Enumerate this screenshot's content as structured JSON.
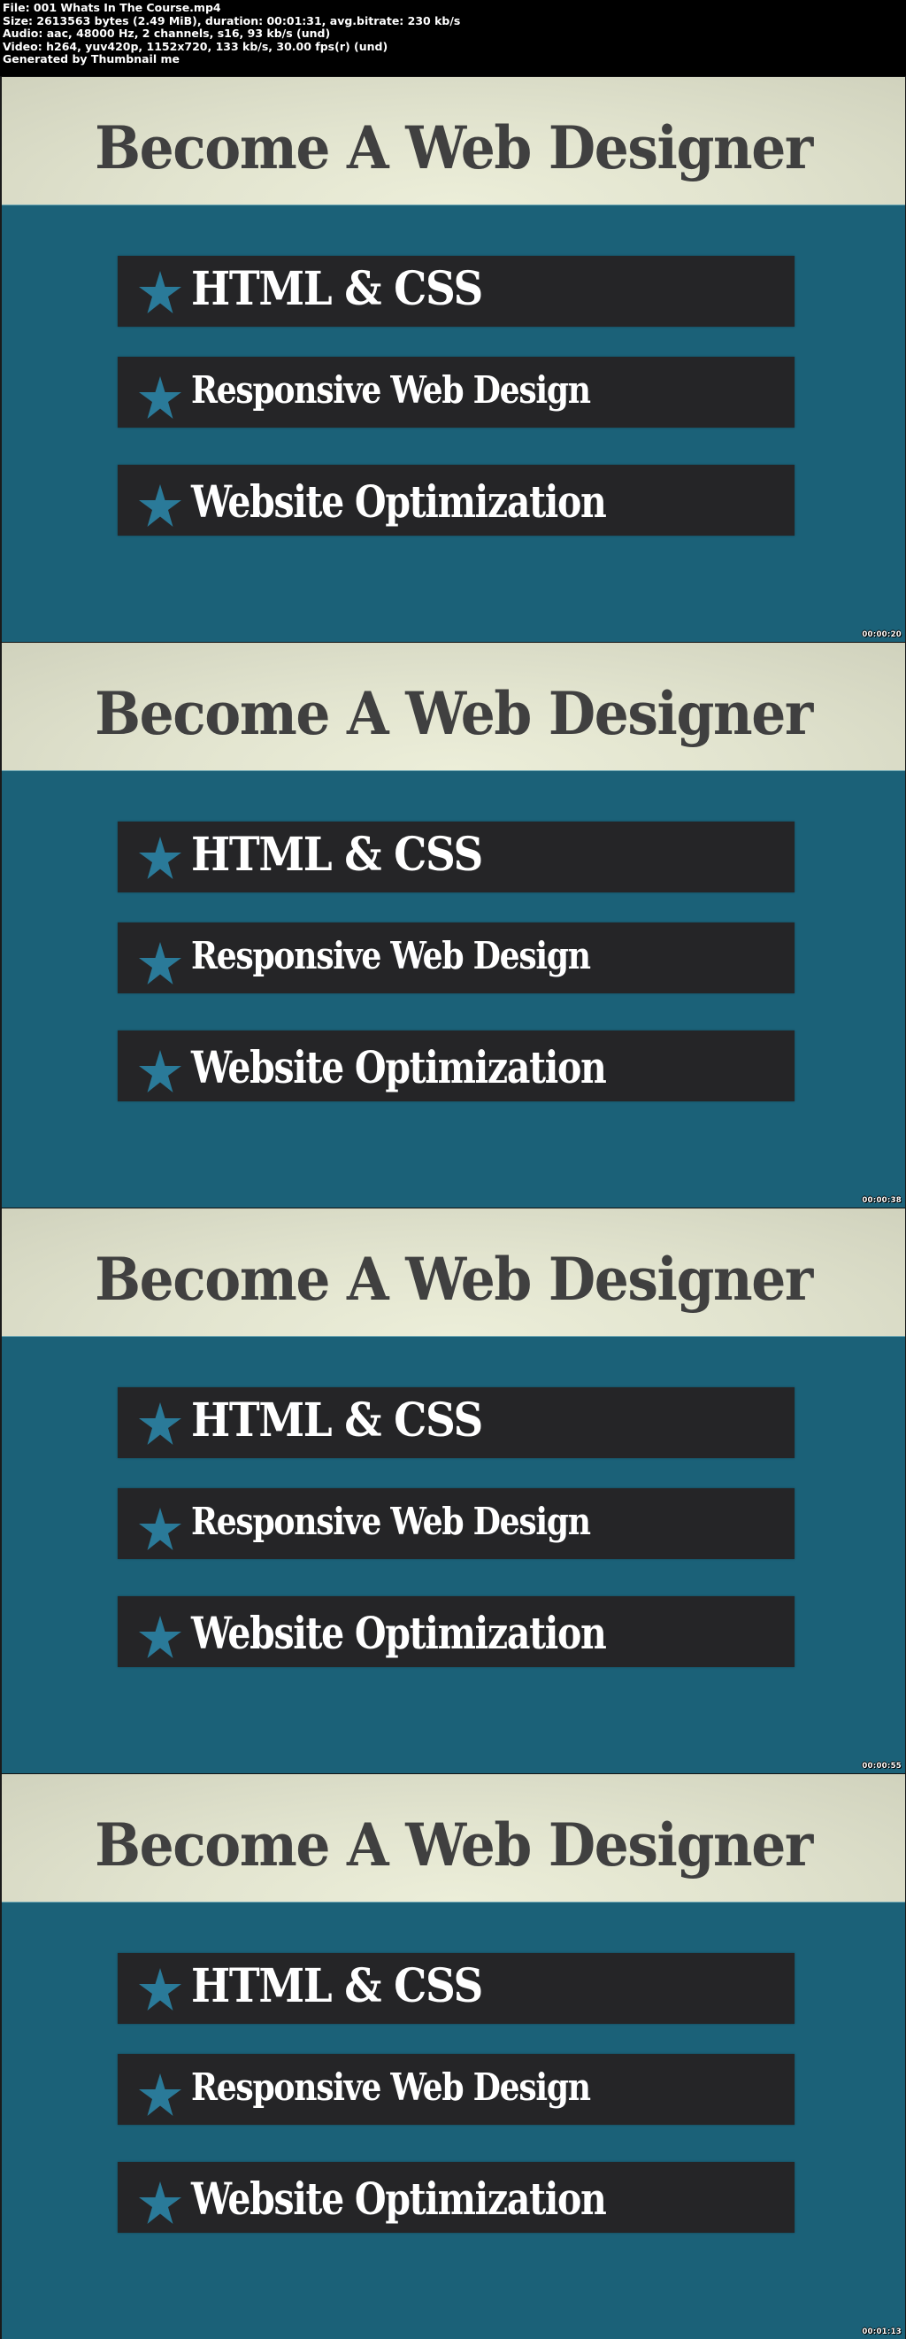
{
  "info": {
    "lines": [
      "File: 001 Whats In The Course.mp4",
      "Size: 2613563 bytes (2.49 MiB), duration: 00:01:31, avg.bitrate: 230 kb/s",
      "Audio: aac, 48000 Hz, 2 channels, s16, 93 kb/s (und)",
      "Video: h264, yuv420p, 1152x720, 133 kb/s, 30.00 fps(r) (und)",
      "Generated by Thumbnail me"
    ]
  },
  "colors": {
    "band": "#e2e4cf",
    "teal": "#1b6178",
    "bar": "#252527",
    "star": "#2a7a99",
    "title_text": "#404040",
    "bar_text": "#ffffff"
  },
  "frames": [
    {
      "title": "Become A Web Designer",
      "items": [
        {
          "icon": "star-icon",
          "label": "HTML & CSS"
        },
        {
          "icon": "star-icon",
          "label": "Responsive Web Design"
        },
        {
          "icon": "star-icon",
          "label": "Website Optimization"
        }
      ],
      "timestamp": "00:00:20"
    },
    {
      "title": "Become A Web Designer",
      "items": [
        {
          "icon": "star-icon",
          "label": "HTML & CSS"
        },
        {
          "icon": "star-icon",
          "label": "Responsive Web Design"
        },
        {
          "icon": "star-icon",
          "label": "Website Optimization"
        }
      ],
      "timestamp": "00:00:38"
    },
    {
      "title": "Become A Web Designer",
      "items": [
        {
          "icon": "star-icon",
          "label": "HTML & CSS"
        },
        {
          "icon": "star-icon",
          "label": "Responsive Web Design"
        },
        {
          "icon": "star-icon",
          "label": "Website Optimization"
        }
      ],
      "timestamp": "00:00:55"
    },
    {
      "title": "Become A Web Designer",
      "items": [
        {
          "icon": "star-icon",
          "label": "HTML & CSS"
        },
        {
          "icon": "star-icon",
          "label": "Responsive Web Design"
        },
        {
          "icon": "star-icon",
          "label": "Website Optimization"
        }
      ],
      "timestamp": "00:01:13"
    }
  ]
}
